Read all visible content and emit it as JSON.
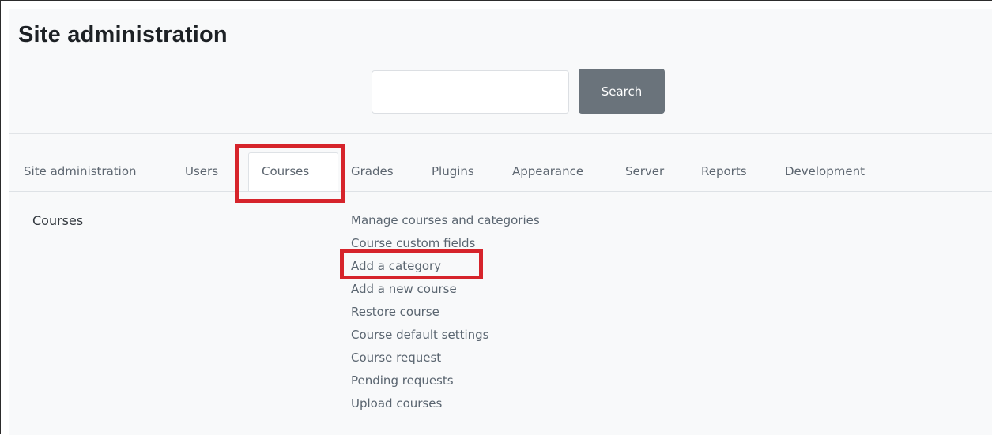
{
  "page": {
    "title": "Site administration"
  },
  "search": {
    "value": "",
    "placeholder": "",
    "button_label": "Search"
  },
  "tabs": [
    {
      "label": "Site administration",
      "active": false
    },
    {
      "label": "Users",
      "active": false
    },
    {
      "label": "Courses",
      "active": true
    },
    {
      "label": "Grades",
      "active": false
    },
    {
      "label": "Plugins",
      "active": false
    },
    {
      "label": "Appearance",
      "active": false
    },
    {
      "label": "Server",
      "active": false
    },
    {
      "label": "Reports",
      "active": false
    },
    {
      "label": "Development",
      "active": false
    }
  ],
  "courses_section": {
    "heading": "Courses",
    "links": [
      "Manage courses and categories",
      "Course custom fields",
      "Add a category",
      "Add a new course",
      "Restore course",
      "Course default settings",
      "Course request",
      "Pending requests",
      "Upload courses"
    ]
  },
  "colors": {
    "annotation_highlight": "#d6242b",
    "search_button": "#6a737b",
    "panel_background": "#f8f9fa"
  }
}
